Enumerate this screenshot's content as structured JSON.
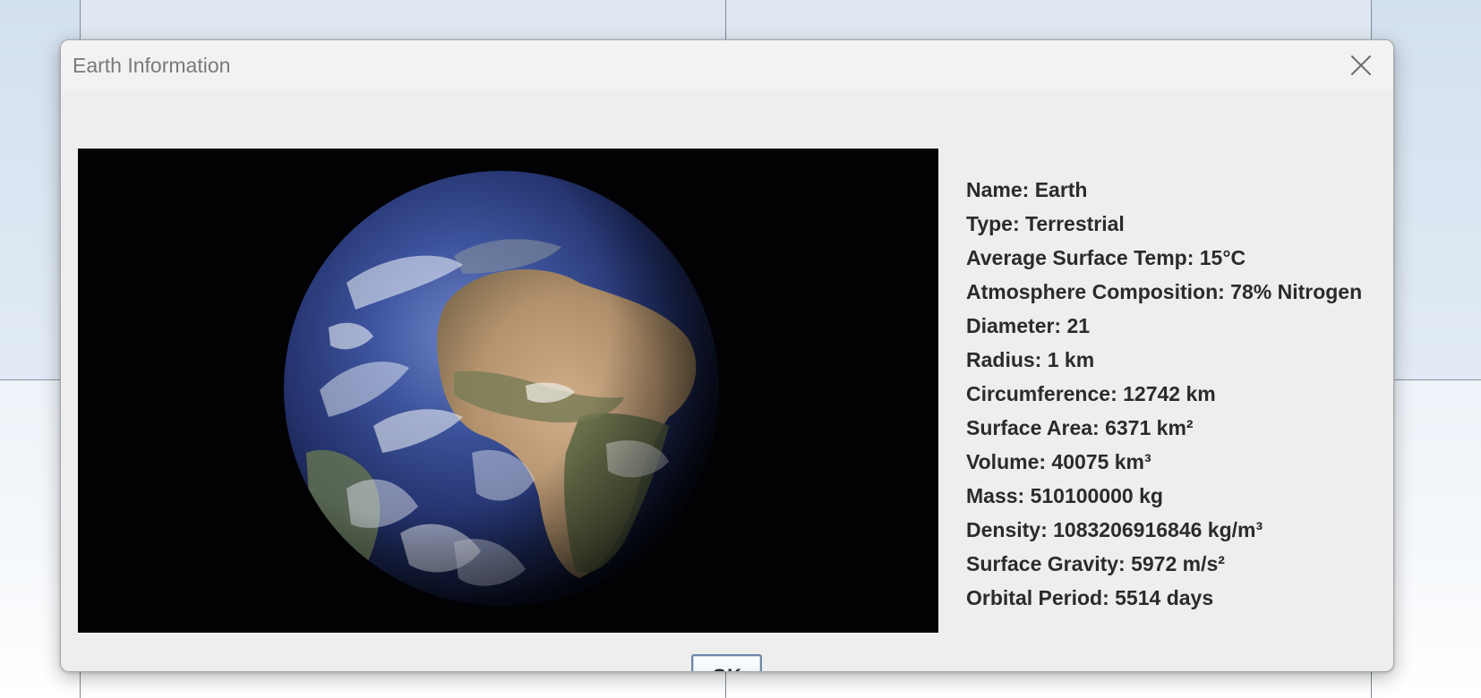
{
  "dialog": {
    "title": "Earth Information",
    "close_icon": "close-icon",
    "image_alt": "Earth",
    "ok_label": "OK"
  },
  "info": [
    "Name: Earth",
    "Type: Terrestrial",
    "Average Surface Temp: 15°C",
    "Atmosphere Composition: 78% Nitrogen",
    "Diameter: 21",
    "Radius: 1 km",
    "Circumference: 12742 km",
    "Surface Area: 6371 km²",
    "Volume: 40075 km³",
    "Mass: 510100000 kg",
    "Density: 1083206916846 kg/m³",
    "Surface Gravity: 5972 m/s²",
    "Orbital Period: 5514 days"
  ],
  "colors": {
    "dialog_bg": "#eeeeee",
    "titlebar_bg": "#f2f2f2",
    "title_text": "#7a7a7a",
    "info_text": "#2b2b2b",
    "ok_border": "#6e87a8",
    "image_bg": "#020104"
  }
}
